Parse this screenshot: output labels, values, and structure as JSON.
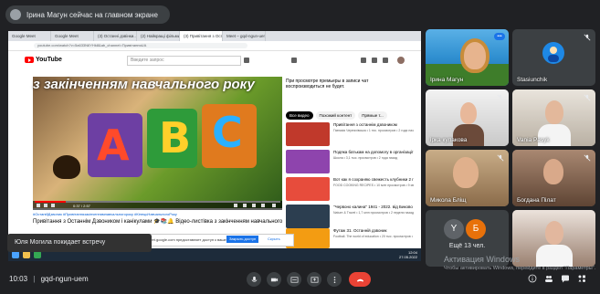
{
  "presenter_banner": {
    "text": "Ірина Магун сейчас на главном экране"
  },
  "browser": {
    "tabs": [
      "Google Meet",
      "Google Meet",
      "(3) Останні дзвінки...",
      "(2) Найкращі фільми...",
      "(3) Привітання з Останн...",
      "Meet – gqd-ngun-uem"
    ],
    "url": "youtube.com/watch?v=5a633N6YHk8&ab_channel=ПривітанняUA"
  },
  "youtube": {
    "search_placeholder": "Введите запрос",
    "video_title_overlay": "з закінченням навчального року",
    "video_time": "0:37 / 2:57",
    "video_tags": "#ОстанійДзвоник #Привітаннязакінченнямнавчальногороку #КінецьНавчальногоРоку",
    "video_title": "Привітання з Останнім Дзвоником і канікулами 🎓📚🔔 Відео-листівка з закінченням навчального",
    "subs_note": "При просмотре премьеры в записи чат воспроизводиться не будет.",
    "chips": [
      "Все видео",
      "Похожий контент",
      "Прямые т..."
    ],
    "recommendations": [
      {
        "title": "Привітання з останнім дзвоником",
        "sub": "Гімназія Черняхівська • 1 тис. просмотров • 2 года назад",
        "color": "#c0392b"
      },
      {
        "title": "Подяка батькам на допомогу в організації дистанційної...",
        "sub": "Школа • 3,1 тыс. просмотров • 2 года назад",
        "color": "#8e44ad"
      },
      {
        "title": "Вот как я сохраняю свежесть клубники 2 года ✅ Рецепт...",
        "sub": "FOOD COOKING RECIPES • 10 млн просмотров • 9 месяцев назад",
        "color": "#e74c3c"
      },
      {
        "title": "\"Червоно калина\" 1941 - 2022. від Биково до Pink Floyd",
        "sub": "Nature & Travel • 1,7 млн просмотров • 2 недели назад",
        "color": "#2c3e50"
      },
      {
        "title": "Футаж 31. Останній дзвоник",
        "sub": "Football. The world of education • 20 тыс. просмотров • 3 года назад",
        "color": "#f39c12"
      }
    ],
    "notification": "meet.google.com предоставляет доступ к вашему экрану.",
    "notification_stop": "Закрыть доступ",
    "notification_hide": "Скрыть",
    "taskbar_time": "12:04",
    "taskbar_date": "27.05.2022"
  },
  "toast": "Юля Могила покидает встречу",
  "participants": [
    {
      "name": "Ірина Магун"
    },
    {
      "name": "Stasiunchik"
    },
    {
      "name": "ірка кулакова"
    },
    {
      "name": "Vania Pasyk"
    },
    {
      "name": "Микола Бліщ"
    },
    {
      "name": "Богдана Пілат"
    },
    {
      "name": "Ещё 13 чел."
    }
  ],
  "more_avatars": [
    "Y",
    "Б"
  ],
  "activation": {
    "title": "Активация Windows",
    "sub": "Чтобы активировать Windows, перейдите в раздел \"Параметры\"."
  },
  "meeting": {
    "time": "10:03",
    "code": "gqd-ngun-uem"
  },
  "colors": {
    "background": "#202124",
    "end_call": "#ea4335",
    "tile": "#3c4043"
  }
}
